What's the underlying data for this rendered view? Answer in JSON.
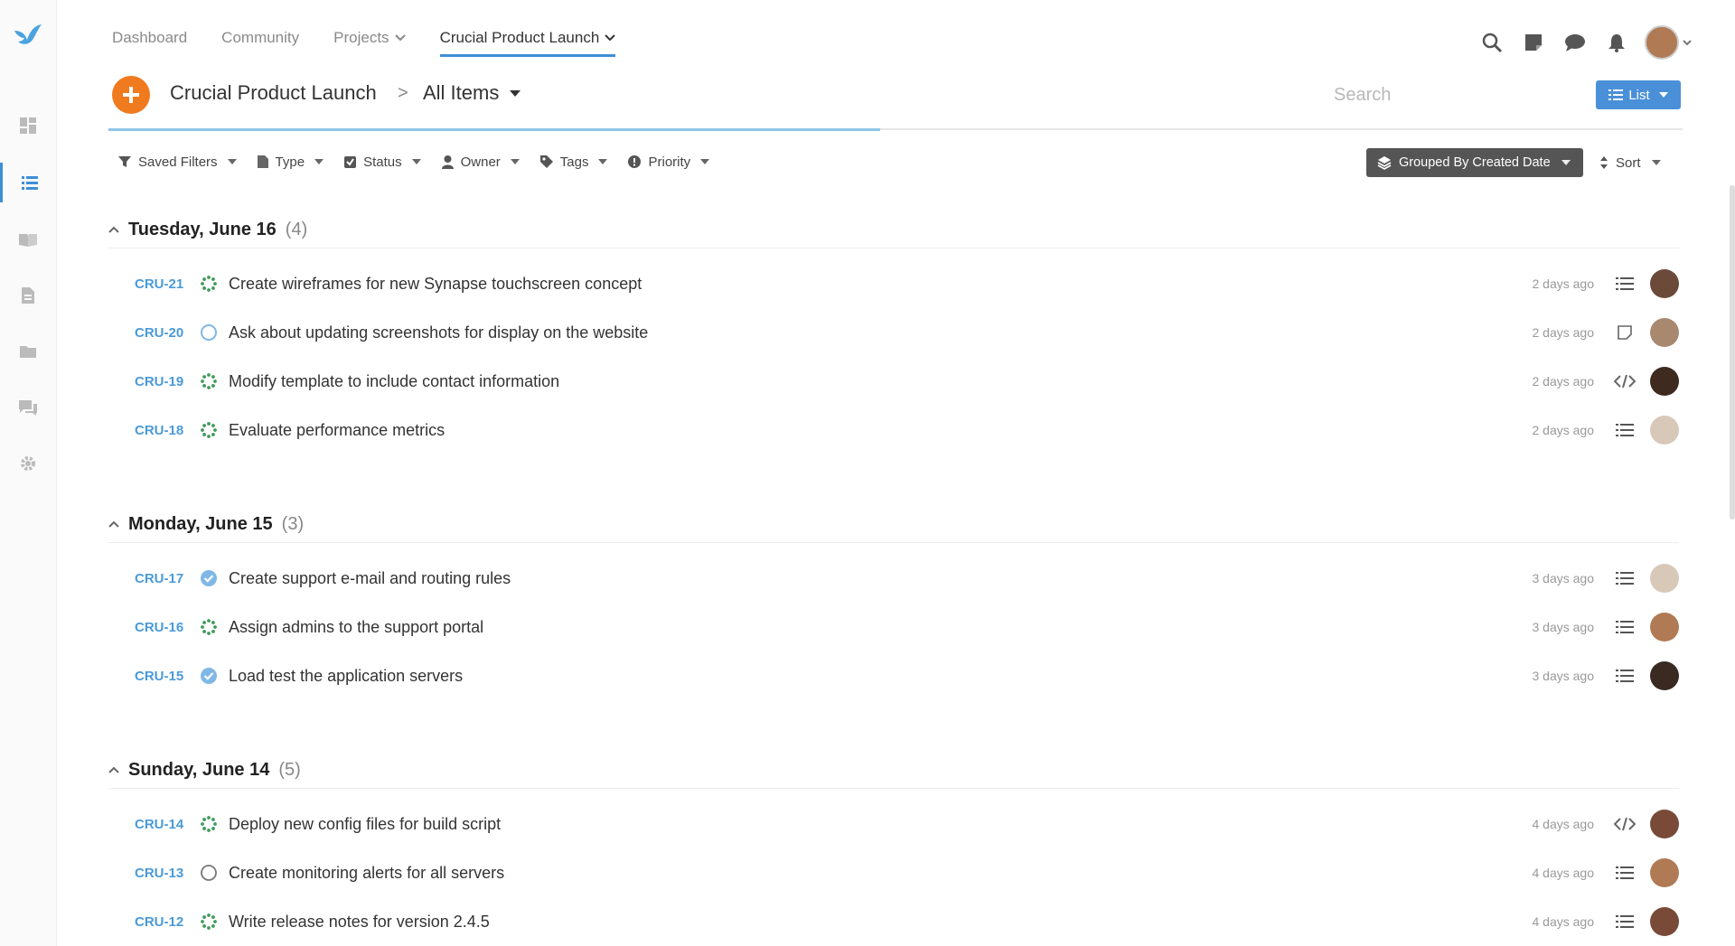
{
  "nav": {
    "items": [
      {
        "label": "Dashboard"
      },
      {
        "label": "Community"
      },
      {
        "label": "Projects"
      },
      {
        "label": "Crucial Product Launch"
      }
    ]
  },
  "header": {
    "project": "Crucial Product Launch",
    "separator": ">",
    "view": "All Items",
    "search_placeholder": "Search",
    "list_label": "List"
  },
  "progress": 0.49,
  "filters": {
    "saved": "Saved Filters",
    "type": "Type",
    "status": "Status",
    "owner": "Owner",
    "tags": "Tags",
    "priority": "Priority",
    "grouped": "Grouped By Created Date",
    "sort": "Sort"
  },
  "colors": {
    "accent": "#4a90d9",
    "orange": "#f07a1e",
    "id": "#4a9ad8"
  },
  "groups": [
    {
      "title": "Tuesday, June 16",
      "count": "(4)",
      "rows": [
        {
          "id": "CRU-21",
          "status": "in-progress",
          "title": "Create wireframes for new Synapse touchscreen concept",
          "time": "2 days ago",
          "type": "checklist-icon",
          "avatar": "#6b4a3a"
        },
        {
          "id": "CRU-20",
          "status": "open-blue",
          "title": "Ask about updating screenshots for display on the website",
          "time": "2 days ago",
          "type": "note-icon",
          "avatar": "#a98870"
        },
        {
          "id": "CRU-19",
          "status": "in-progress",
          "title": "Modify template to include contact information",
          "time": "2 days ago",
          "type": "code-icon",
          "avatar": "#3e2a1f"
        },
        {
          "id": "CRU-18",
          "status": "in-progress",
          "title": "Evaluate performance metrics",
          "time": "2 days ago",
          "type": "checklist-icon",
          "avatar": "#d8c8b8"
        }
      ]
    },
    {
      "title": "Monday, June 15",
      "count": "(3)",
      "rows": [
        {
          "id": "CRU-17",
          "status": "done",
          "title": "Create support e-mail and routing rules",
          "time": "3 days ago",
          "type": "checklist-icon",
          "avatar": "#d8c8b8"
        },
        {
          "id": "CRU-16",
          "status": "in-progress",
          "title": "Assign admins to the support portal",
          "time": "3 days ago",
          "type": "checklist-icon",
          "avatar": "#b07a55"
        },
        {
          "id": "CRU-15",
          "status": "done",
          "title": "Load test the application servers",
          "time": "3 days ago",
          "type": "checklist-icon",
          "avatar": "#3a2a22"
        }
      ]
    },
    {
      "title": "Sunday, June 14",
      "count": "(5)",
      "rows": [
        {
          "id": "CRU-14",
          "status": "in-progress",
          "title": "Deploy new config files for build script",
          "time": "4 days ago",
          "type": "code-icon",
          "avatar": "#7a4a38"
        },
        {
          "id": "CRU-13",
          "status": "open-grey",
          "title": "Create monitoring alerts for all servers",
          "time": "4 days ago",
          "type": "checklist-icon",
          "avatar": "#b07a55"
        },
        {
          "id": "CRU-12",
          "status": "in-progress",
          "title": "Write release notes for version 2.4.5",
          "time": "4 days ago",
          "type": "checklist-icon",
          "avatar": "#7a4a38"
        }
      ]
    }
  ]
}
